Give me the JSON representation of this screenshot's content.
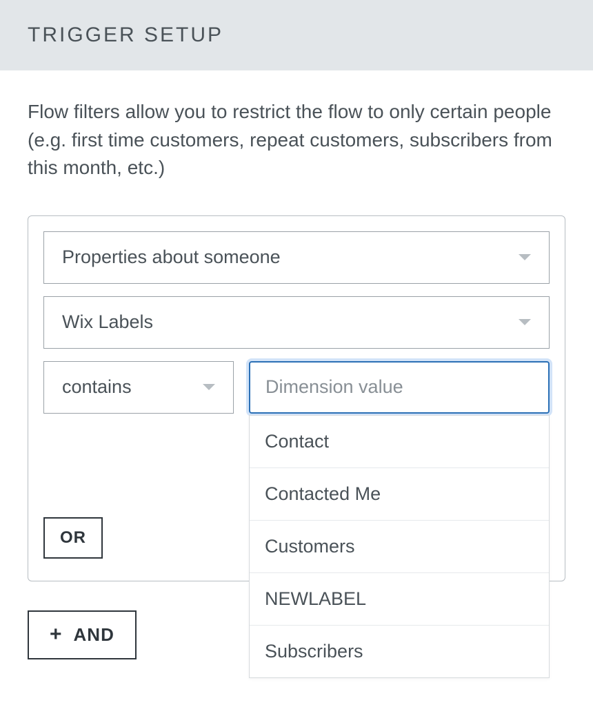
{
  "header": {
    "title": "TRIGGER SETUP"
  },
  "description": "Flow filters allow you to restrict the flow to only certain people (e.g. first time customers, repeat customers, subscribers from this month, etc.)",
  "filter": {
    "property_select": "Properties about someone",
    "dimension_select": "Wix Labels",
    "operator_select": "contains",
    "value_placeholder": "Dimension value",
    "options": [
      "Contact",
      "Contacted Me",
      "Customers",
      "NEWLABEL",
      "Subscribers"
    ],
    "or_label": "OR",
    "and_label": "AND"
  }
}
